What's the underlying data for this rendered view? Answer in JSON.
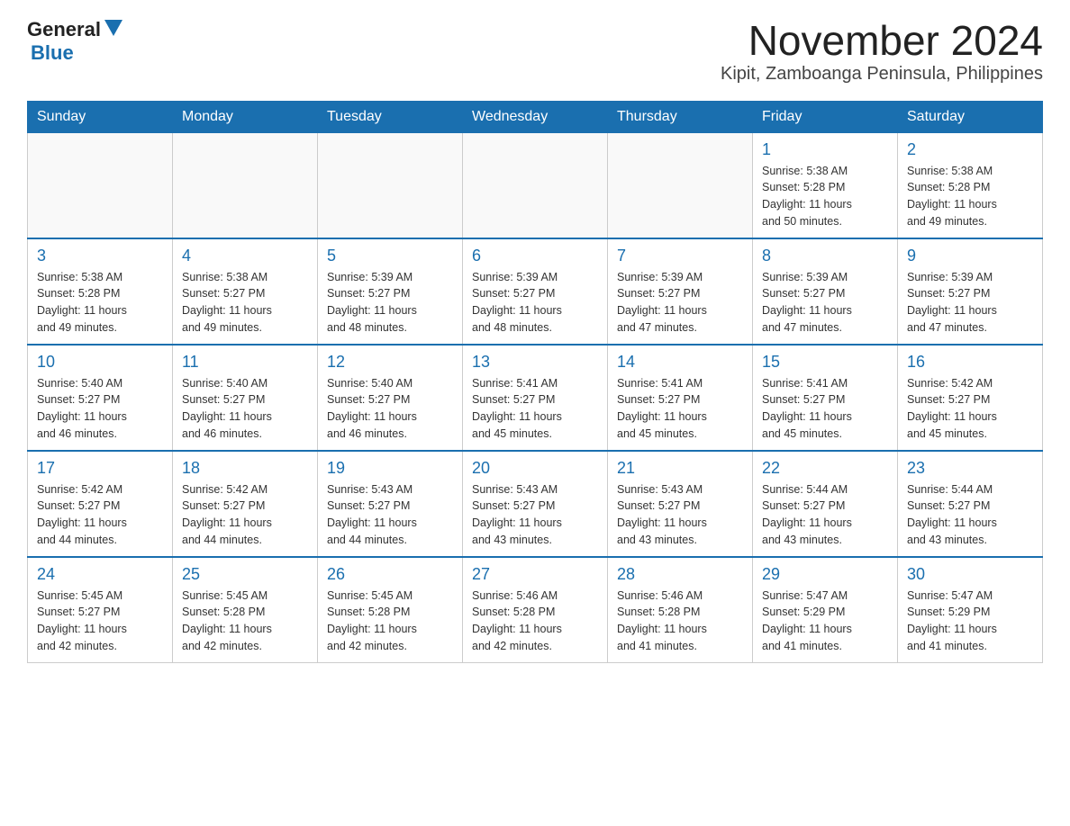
{
  "header": {
    "logo": {
      "text_general": "General",
      "text_blue": "Blue"
    },
    "title": "November 2024",
    "subtitle": "Kipit, Zamboanga Peninsula, Philippines"
  },
  "calendar": {
    "days_of_week": [
      "Sunday",
      "Monday",
      "Tuesday",
      "Wednesday",
      "Thursday",
      "Friday",
      "Saturday"
    ],
    "weeks": [
      [
        {
          "day": "",
          "info": ""
        },
        {
          "day": "",
          "info": ""
        },
        {
          "day": "",
          "info": ""
        },
        {
          "day": "",
          "info": ""
        },
        {
          "day": "",
          "info": ""
        },
        {
          "day": "1",
          "info": "Sunrise: 5:38 AM\nSunset: 5:28 PM\nDaylight: 11 hours\nand 50 minutes."
        },
        {
          "day": "2",
          "info": "Sunrise: 5:38 AM\nSunset: 5:28 PM\nDaylight: 11 hours\nand 49 minutes."
        }
      ],
      [
        {
          "day": "3",
          "info": "Sunrise: 5:38 AM\nSunset: 5:28 PM\nDaylight: 11 hours\nand 49 minutes."
        },
        {
          "day": "4",
          "info": "Sunrise: 5:38 AM\nSunset: 5:27 PM\nDaylight: 11 hours\nand 49 minutes."
        },
        {
          "day": "5",
          "info": "Sunrise: 5:39 AM\nSunset: 5:27 PM\nDaylight: 11 hours\nand 48 minutes."
        },
        {
          "day": "6",
          "info": "Sunrise: 5:39 AM\nSunset: 5:27 PM\nDaylight: 11 hours\nand 48 minutes."
        },
        {
          "day": "7",
          "info": "Sunrise: 5:39 AM\nSunset: 5:27 PM\nDaylight: 11 hours\nand 47 minutes."
        },
        {
          "day": "8",
          "info": "Sunrise: 5:39 AM\nSunset: 5:27 PM\nDaylight: 11 hours\nand 47 minutes."
        },
        {
          "day": "9",
          "info": "Sunrise: 5:39 AM\nSunset: 5:27 PM\nDaylight: 11 hours\nand 47 minutes."
        }
      ],
      [
        {
          "day": "10",
          "info": "Sunrise: 5:40 AM\nSunset: 5:27 PM\nDaylight: 11 hours\nand 46 minutes."
        },
        {
          "day": "11",
          "info": "Sunrise: 5:40 AM\nSunset: 5:27 PM\nDaylight: 11 hours\nand 46 minutes."
        },
        {
          "day": "12",
          "info": "Sunrise: 5:40 AM\nSunset: 5:27 PM\nDaylight: 11 hours\nand 46 minutes."
        },
        {
          "day": "13",
          "info": "Sunrise: 5:41 AM\nSunset: 5:27 PM\nDaylight: 11 hours\nand 45 minutes."
        },
        {
          "day": "14",
          "info": "Sunrise: 5:41 AM\nSunset: 5:27 PM\nDaylight: 11 hours\nand 45 minutes."
        },
        {
          "day": "15",
          "info": "Sunrise: 5:41 AM\nSunset: 5:27 PM\nDaylight: 11 hours\nand 45 minutes."
        },
        {
          "day": "16",
          "info": "Sunrise: 5:42 AM\nSunset: 5:27 PM\nDaylight: 11 hours\nand 45 minutes."
        }
      ],
      [
        {
          "day": "17",
          "info": "Sunrise: 5:42 AM\nSunset: 5:27 PM\nDaylight: 11 hours\nand 44 minutes."
        },
        {
          "day": "18",
          "info": "Sunrise: 5:42 AM\nSunset: 5:27 PM\nDaylight: 11 hours\nand 44 minutes."
        },
        {
          "day": "19",
          "info": "Sunrise: 5:43 AM\nSunset: 5:27 PM\nDaylight: 11 hours\nand 44 minutes."
        },
        {
          "day": "20",
          "info": "Sunrise: 5:43 AM\nSunset: 5:27 PM\nDaylight: 11 hours\nand 43 minutes."
        },
        {
          "day": "21",
          "info": "Sunrise: 5:43 AM\nSunset: 5:27 PM\nDaylight: 11 hours\nand 43 minutes."
        },
        {
          "day": "22",
          "info": "Sunrise: 5:44 AM\nSunset: 5:27 PM\nDaylight: 11 hours\nand 43 minutes."
        },
        {
          "day": "23",
          "info": "Sunrise: 5:44 AM\nSunset: 5:27 PM\nDaylight: 11 hours\nand 43 minutes."
        }
      ],
      [
        {
          "day": "24",
          "info": "Sunrise: 5:45 AM\nSunset: 5:27 PM\nDaylight: 11 hours\nand 42 minutes."
        },
        {
          "day": "25",
          "info": "Sunrise: 5:45 AM\nSunset: 5:28 PM\nDaylight: 11 hours\nand 42 minutes."
        },
        {
          "day": "26",
          "info": "Sunrise: 5:45 AM\nSunset: 5:28 PM\nDaylight: 11 hours\nand 42 minutes."
        },
        {
          "day": "27",
          "info": "Sunrise: 5:46 AM\nSunset: 5:28 PM\nDaylight: 11 hours\nand 42 minutes."
        },
        {
          "day": "28",
          "info": "Sunrise: 5:46 AM\nSunset: 5:28 PM\nDaylight: 11 hours\nand 41 minutes."
        },
        {
          "day": "29",
          "info": "Sunrise: 5:47 AM\nSunset: 5:29 PM\nDaylight: 11 hours\nand 41 minutes."
        },
        {
          "day": "30",
          "info": "Sunrise: 5:47 AM\nSunset: 5:29 PM\nDaylight: 11 hours\nand 41 minutes."
        }
      ]
    ]
  }
}
